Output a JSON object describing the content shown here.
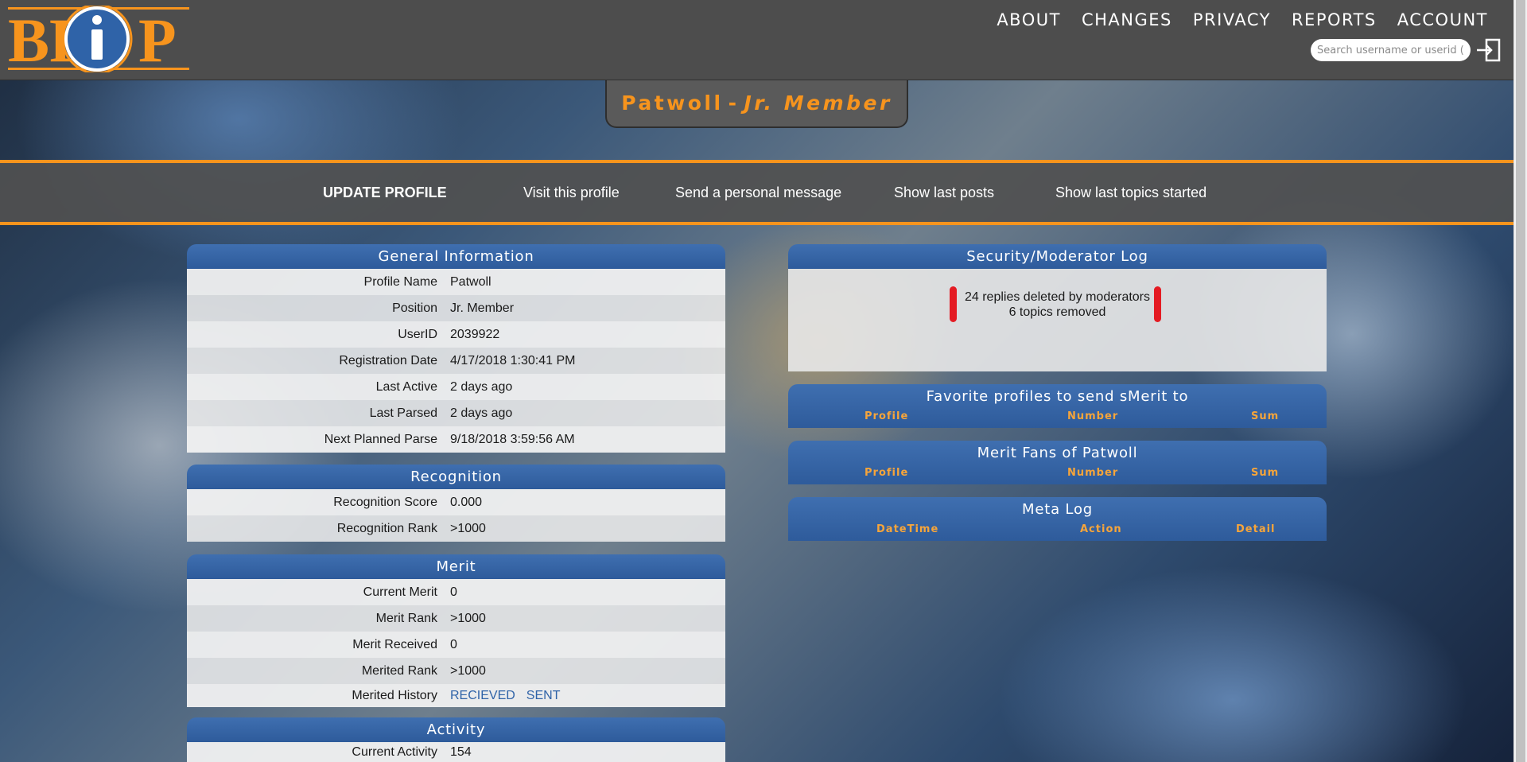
{
  "header": {
    "logo_text": "BPiP",
    "nav": [
      "ABOUT",
      "CHANGES",
      "PRIVACY",
      "REPORTS",
      "ACCOUNT"
    ],
    "search_placeholder": "Search username or userid (UID)"
  },
  "profile_title": {
    "name": "Patwoll",
    "separator": "-",
    "rank": "Jr. Member"
  },
  "subnav": {
    "update": "UPDATE PROFILE",
    "visit": "Visit this profile",
    "message": "Send a personal message",
    "posts": "Show last posts",
    "topics": "Show last topics started"
  },
  "general": {
    "title": "General Information",
    "rows": [
      {
        "k": "Profile Name",
        "v": "Patwoll"
      },
      {
        "k": "Position",
        "v": "Jr. Member"
      },
      {
        "k": "UserID",
        "v": "2039922"
      },
      {
        "k": "Registration Date",
        "v": "4/17/2018 1:30:41 PM"
      },
      {
        "k": "Last Active",
        "v": "2 days ago"
      },
      {
        "k": "Last Parsed",
        "v": "2 days ago"
      },
      {
        "k": "Next Planned Parse",
        "v": "9/18/2018 3:59:56 AM"
      }
    ]
  },
  "recognition": {
    "title": "Recognition",
    "rows": [
      {
        "k": "Recognition Score",
        "v": "0.000"
      },
      {
        "k": "Recognition Rank",
        "v": ">1000"
      }
    ]
  },
  "merit": {
    "title": "Merit",
    "rows": [
      {
        "k": "Current Merit",
        "v": "0"
      },
      {
        "k": "Merit Rank",
        "v": ">1000"
      },
      {
        "k": "Merit Received",
        "v": "0"
      },
      {
        "k": "Merited Rank",
        "v": ">1000"
      }
    ],
    "history_label": "Merited History",
    "history_received": "RECIEVED",
    "history_sent": "SENT"
  },
  "activity": {
    "title": "Activity",
    "current_label": "Current Activity",
    "current_value": "154"
  },
  "security": {
    "title": "Security/Moderator Log",
    "line1": "24 replies deleted by moderators",
    "line2": "6 topics removed",
    "accent_color": "#e41b23"
  },
  "favorites": {
    "title": "Favorite profiles to send sMerit to",
    "cols": [
      "Profile",
      "Number",
      "Sum"
    ]
  },
  "fans": {
    "title": "Merit Fans of Patwoll",
    "cols": [
      "Profile",
      "Number",
      "Sum"
    ]
  },
  "meta": {
    "title": "Meta Log",
    "cols": [
      "DateTime",
      "Action",
      "Detail"
    ]
  },
  "colors": {
    "accent": "#f7941d",
    "panel_blue": "#2e5b9b",
    "header_gray": "#4d4d4d"
  }
}
